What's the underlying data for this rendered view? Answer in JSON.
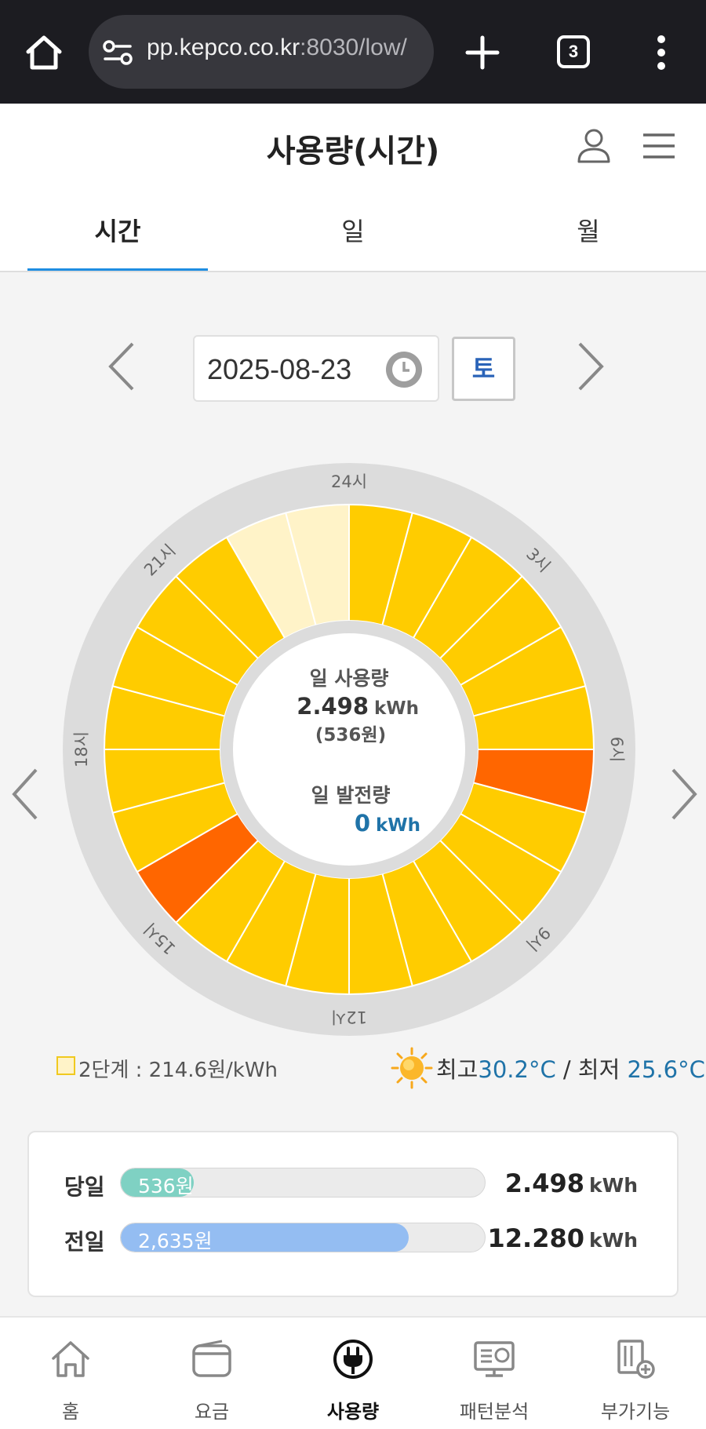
{
  "browser": {
    "url_host": "pp.kepco.co.kr",
    "url_rest": ":8030/low/",
    "tab_count": "3"
  },
  "header": {
    "title": "사용량(시간)",
    "tabs": [
      {
        "label": "시간",
        "active": true
      },
      {
        "label": "일",
        "active": false
      },
      {
        "label": "월",
        "active": false
      }
    ]
  },
  "date_nav": {
    "date": "2025-08-23",
    "weekday": "토"
  },
  "dial": {
    "hour_labels": [
      "24시",
      "3시",
      "6시",
      "9시",
      "12시",
      "15시",
      "18시",
      "21시"
    ],
    "center": {
      "usage_title": "일 사용량",
      "usage_value": "2.498",
      "usage_unit": "kWh",
      "usage_cost": "(536원)",
      "gen_title": "일 발전량",
      "gen_value": "0",
      "gen_unit": "kWh"
    },
    "colors": {
      "ring": "#dcdcdc",
      "normal": "#ffcc00",
      "low": "#fff3c8",
      "high": "#ff6600"
    },
    "hour_levels": [
      "normal",
      "normal",
      "normal",
      "normal",
      "normal",
      "normal",
      "high",
      "normal",
      "normal",
      "normal",
      "normal",
      "normal",
      "normal",
      "normal",
      "normal",
      "high",
      "normal",
      "normal",
      "normal",
      "normal",
      "normal",
      "normal",
      "low",
      "low"
    ]
  },
  "legend": {
    "tier_text": "2단계 : 214.6원/kWh"
  },
  "weather": {
    "max_label": "최고",
    "max_value": "30.2°C",
    "separator": " / ",
    "min_label": "최저 ",
    "min_value": "25.6°C"
  },
  "compare": {
    "rows": [
      {
        "label": "당일",
        "cost": "536원",
        "value": "2.498",
        "unit": "kWh",
        "ratio": 0.2,
        "color": "#7fd1c3"
      },
      {
        "label": "전일",
        "cost": "2,635원",
        "value": "12.280",
        "unit": "kWh",
        "ratio": 0.79,
        "color": "#94bdf2"
      }
    ]
  },
  "bottom_nav": [
    {
      "label": "홈",
      "icon": "home-icon",
      "active": false
    },
    {
      "label": "요금",
      "icon": "wallet-icon",
      "active": false
    },
    {
      "label": "사용량",
      "icon": "plug-icon",
      "active": true
    },
    {
      "label": "패턴분석",
      "icon": "monitor-chart-icon",
      "active": false
    },
    {
      "label": "부가기능",
      "icon": "add-feature-icon",
      "active": false
    }
  ]
}
